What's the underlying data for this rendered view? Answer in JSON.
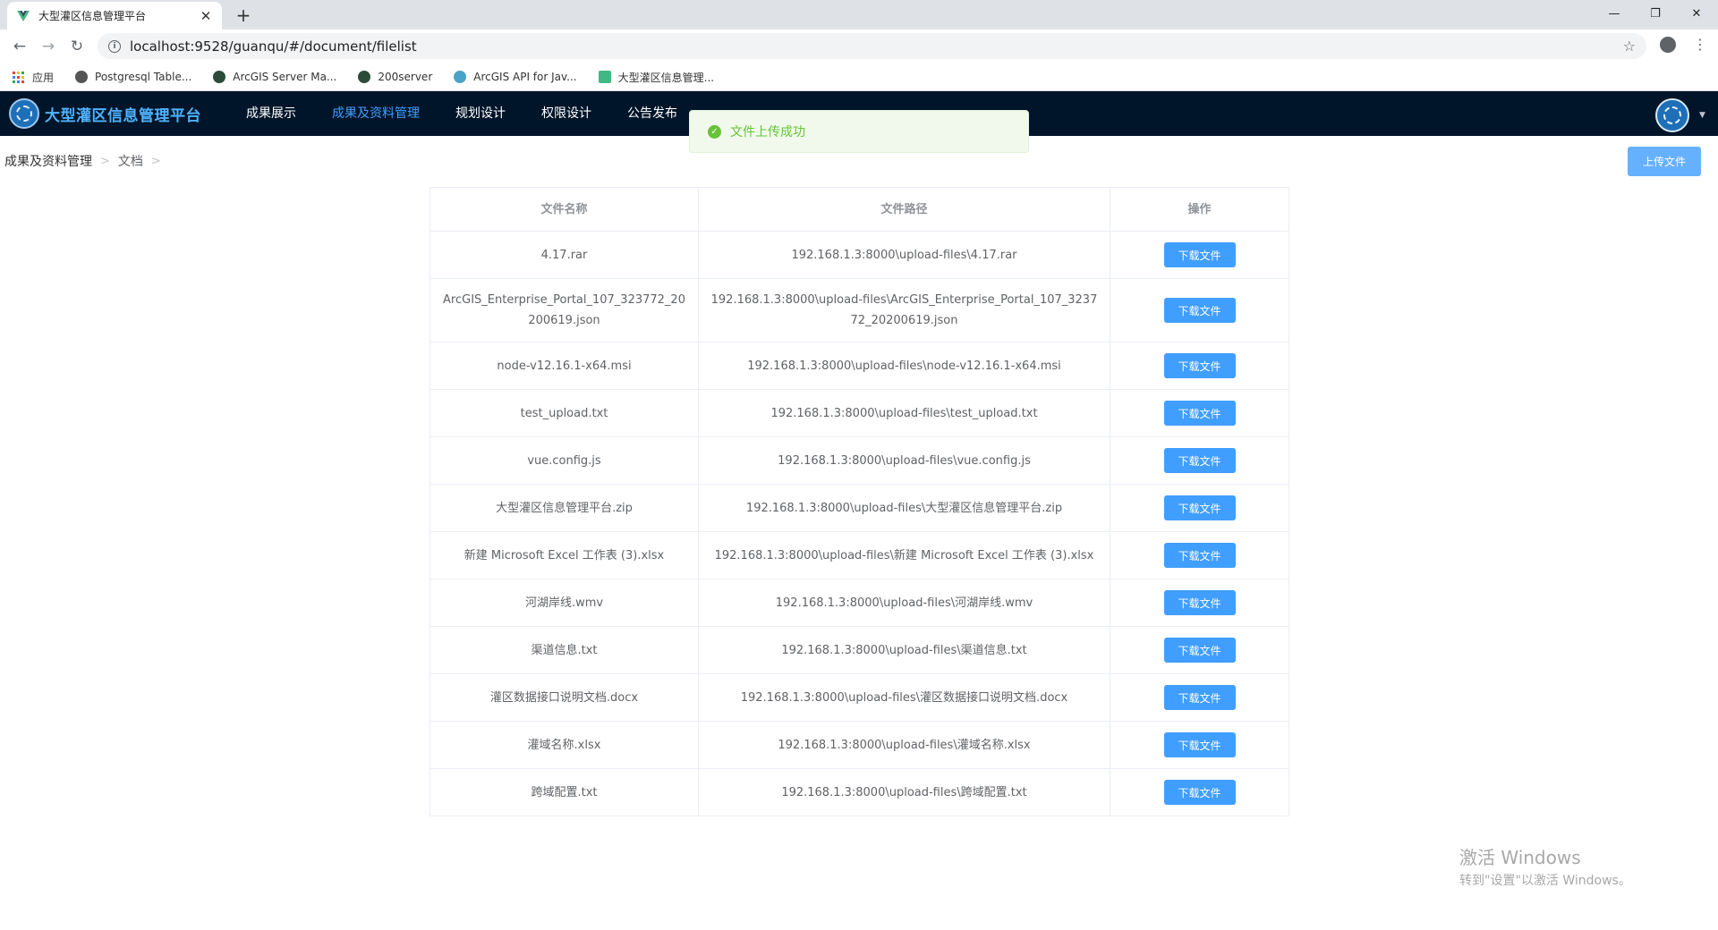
{
  "browser": {
    "tab_title": "大型灌区信息管理平台",
    "url": "localhost:9528/guanqu/#/document/filelist",
    "bookmarks": [
      {
        "label": "应用",
        "icon": "apps-grid-icon"
      },
      {
        "label": "Postgresql Table...",
        "icon": "globe-icon"
      },
      {
        "label": "ArcGIS Server Ma...",
        "icon": "globe-icon"
      },
      {
        "label": "200server",
        "icon": "globe-icon"
      },
      {
        "label": "ArcGIS API for Jav...",
        "icon": "esri-icon"
      },
      {
        "label": "大型灌区信息管理...",
        "icon": "vue-icon"
      }
    ],
    "colors": {
      "tabstrip": "#dee1e6",
      "omnibox": "#f1f3f4"
    }
  },
  "app": {
    "brand": "大型灌区信息管理平台",
    "nav": [
      {
        "label": "成果展示",
        "active": false
      },
      {
        "label": "成果及资料管理",
        "active": true
      },
      {
        "label": "规划设计",
        "active": false
      },
      {
        "label": "权限设计",
        "active": false
      },
      {
        "label": "公告发布",
        "active": false
      }
    ],
    "colors": {
      "header_bg": "#001529",
      "primary": "#409eff",
      "success": "#67c23a"
    }
  },
  "toast": {
    "message": "文件上传成功",
    "type": "success"
  },
  "breadcrumb": [
    "成果及资料管理",
    "文档"
  ],
  "upload_button": "上传文件",
  "table": {
    "columns": [
      "文件名称",
      "文件路径",
      "操作"
    ],
    "action_label": "下载文件",
    "rows": [
      {
        "name": "4.17.rar",
        "path": "192.168.1.3:8000\\upload-files\\4.17.rar"
      },
      {
        "name": "ArcGIS_Enterprise_Portal_107_323772_20200619.json",
        "path": "192.168.1.3:8000\\upload-files\\ArcGIS_Enterprise_Portal_107_323772_20200619.json"
      },
      {
        "name": "node-v12.16.1-x64.msi",
        "path": "192.168.1.3:8000\\upload-files\\node-v12.16.1-x64.msi"
      },
      {
        "name": "test_upload.txt",
        "path": "192.168.1.3:8000\\upload-files\\test_upload.txt"
      },
      {
        "name": "vue.config.js",
        "path": "192.168.1.3:8000\\upload-files\\vue.config.js"
      },
      {
        "name": "大型灌区信息管理平台.zip",
        "path": "192.168.1.3:8000\\upload-files\\大型灌区信息管理平台.zip"
      },
      {
        "name": "新建 Microsoft Excel 工作表 (3).xlsx",
        "path": "192.168.1.3:8000\\upload-files\\新建 Microsoft Excel 工作表 (3).xlsx"
      },
      {
        "name": "河湖岸线.wmv",
        "path": "192.168.1.3:8000\\upload-files\\河湖岸线.wmv"
      },
      {
        "name": "渠道信息.txt",
        "path": "192.168.1.3:8000\\upload-files\\渠道信息.txt"
      },
      {
        "name": "灌区数据接口说明文档.docx",
        "path": "192.168.1.3:8000\\upload-files\\灌区数据接口说明文档.docx"
      },
      {
        "name": "灌域名称.xlsx",
        "path": "192.168.1.3:8000\\upload-files\\灌域名称.xlsx"
      },
      {
        "name": "跨域配置.txt",
        "path": "192.168.1.3:8000\\upload-files\\跨域配置.txt"
      }
    ]
  },
  "watermark": {
    "title": "激活 Windows",
    "subtitle": "转到\"设置\"以激活 Windows。"
  }
}
